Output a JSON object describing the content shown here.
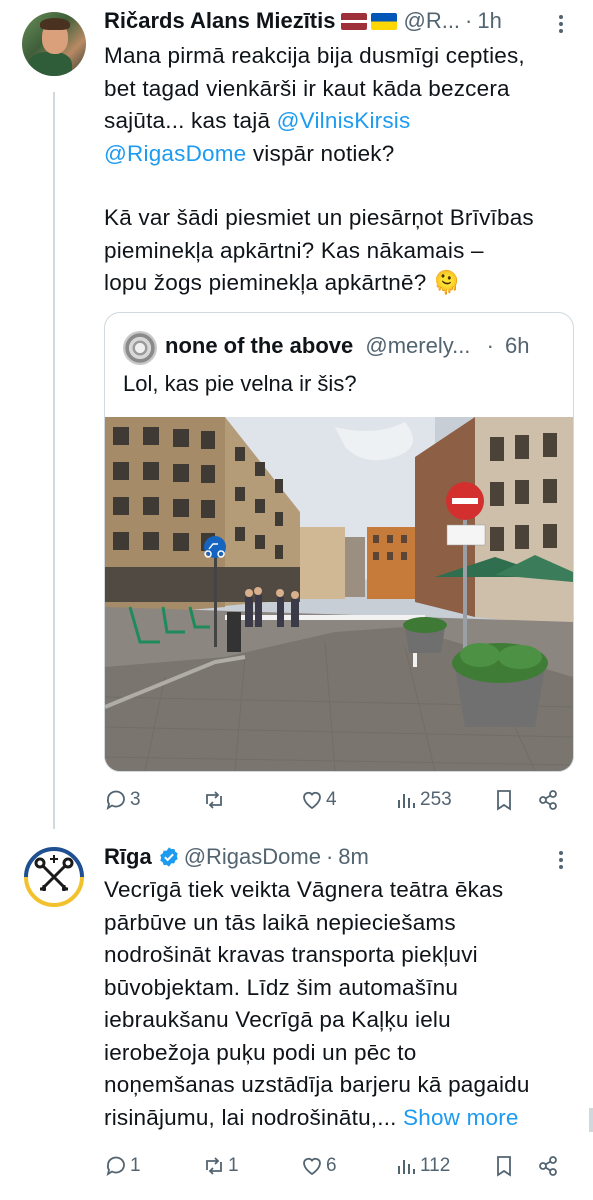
{
  "tweet1": {
    "author_name": "Ričards Alans Miezītis",
    "handle": "@R...",
    "dot": "·",
    "time": "1h",
    "line1": "Mana pirmā reakcija bija dusmīgi cepties,",
    "line2": "bet tagad vienkārši ir kaut kāda bezcera",
    "line3_text": "sajūta... kas tajā ",
    "line3_link": "@VilnisKirsis",
    "line4_link": "@RigasDome",
    "line4_text": " vispār notiek?",
    "line5": "Kā var šādi piesmiet un piesārņot Brīvības",
    "line6": "pieminekļa apkārtni? Kas nākamais –",
    "line7": "lopu žogs pieminekļa apkārtnē? 🫠",
    "quote": {
      "author_name": "none of the above",
      "handle": "@merely...",
      "dot": "·",
      "time": "6h",
      "text": "Lol, kas pie velna ir šis?"
    },
    "actions": {
      "replies": "3",
      "likes": "4",
      "views": "253"
    }
  },
  "tweet2": {
    "author_name": "Rīga",
    "handle": "@RigasDome",
    "dot": "·",
    "time": "8m",
    "lines": [
      "Vecrīgā tiek veikta Vāgnera teātra ēkas",
      "pārbūve un tās laikā nepieciešams",
      "nodrošināt kravas transporta piekļuvi",
      "būvobjektam. Līdz šim automašīnu",
      "iebraukšanu Vecrīgā pa Kaļķu ielu",
      "ierobežoja puķu podi un pēc to",
      "noņemšanas uzstādīja barjeru kā pagaidu"
    ],
    "last_line": "risinājumu, lai nodrošinātu,...",
    "show_more": "Show more",
    "actions": {
      "replies": "1",
      "reposts": "1",
      "likes": "6",
      "views": "112"
    }
  },
  "colors": {
    "accent": "#1d9bf0",
    "muted": "#536471",
    "border": "#cfd9de"
  },
  "icons": [
    "reply-icon",
    "repost-icon",
    "like-icon",
    "views-icon",
    "bookmark-icon",
    "share-icon",
    "verified-icon",
    "more-icon"
  ]
}
